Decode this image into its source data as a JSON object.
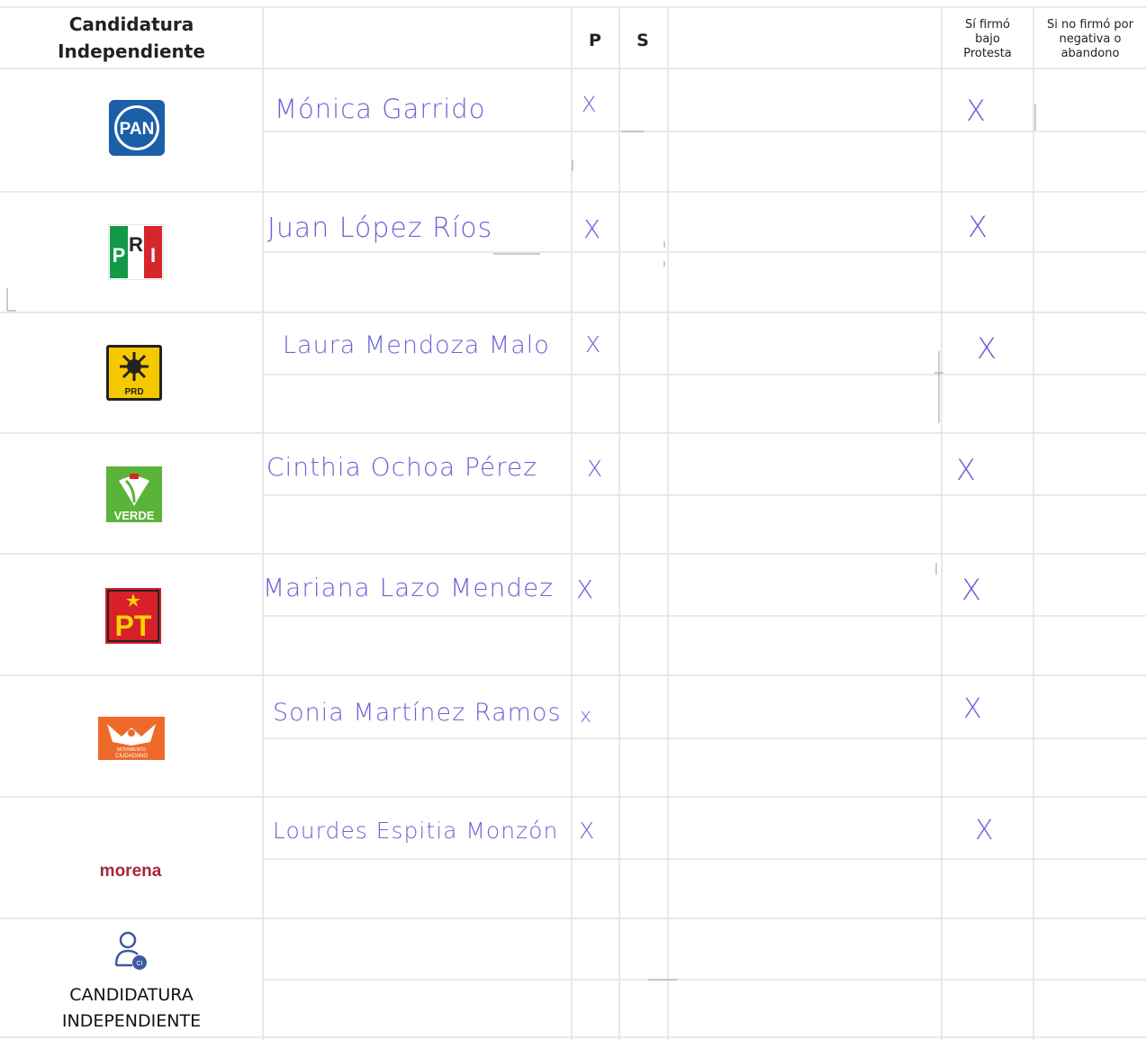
{
  "header": {
    "candidatura": "Candidatura Independiente",
    "p": "P",
    "s": "S",
    "firmo": "Sí firmó bajo Protesta",
    "no_firmo": "Si no firmó por negativa o abandono"
  },
  "rows": [
    {
      "party": "PAN",
      "name": "Mónica Garrido",
      "p": "X",
      "firmo": "X"
    },
    {
      "party": "PRI",
      "name": "Juan López Ríos",
      "p": "X",
      "firmo": "X"
    },
    {
      "party": "PRD",
      "name": "Laura Mendoza Malo",
      "p": "X",
      "firmo": "X"
    },
    {
      "party": "VERDE",
      "name": "Cinthia Ochoa Pérez",
      "p": "X",
      "firmo": "X"
    },
    {
      "party": "PT",
      "name": "Mariana Lazo Mendez",
      "p": "X",
      "firmo": "X"
    },
    {
      "party": "MOVIMIENTO CIUDADANO",
      "name": "Sonia Martínez Ramos",
      "p": "x",
      "firmo": "X"
    },
    {
      "party": "morena",
      "name": "Lourdes Espitia Monzón",
      "p": "X",
      "firmo": "X"
    }
  ],
  "independent": {
    "label_line1": "CANDIDATURA",
    "label_line2": "INDEPENDIENTE"
  },
  "logos": {
    "pan": "PAN",
    "pri_p": "P",
    "pri_r": "R",
    "pri_i": "I",
    "prd": "PRD",
    "verde": "VERDE",
    "pt": "PT",
    "mc_line1": "MOVIMIENTO",
    "mc_line2": "CIUDADANO",
    "morena": "morena",
    "indep_badge": "CI"
  },
  "colors": {
    "ink": "#6b63d6",
    "grid": "#e2e2e2",
    "pan_blue": "#1b5fa8",
    "pri_green": "#129a48",
    "pri_red": "#d6262b",
    "prd_yellow": "#f6c800",
    "verde_green": "#5cb33a",
    "pt_red": "#d8202a",
    "mc_orange": "#ee6a2b",
    "morena": "#a5283d"
  }
}
